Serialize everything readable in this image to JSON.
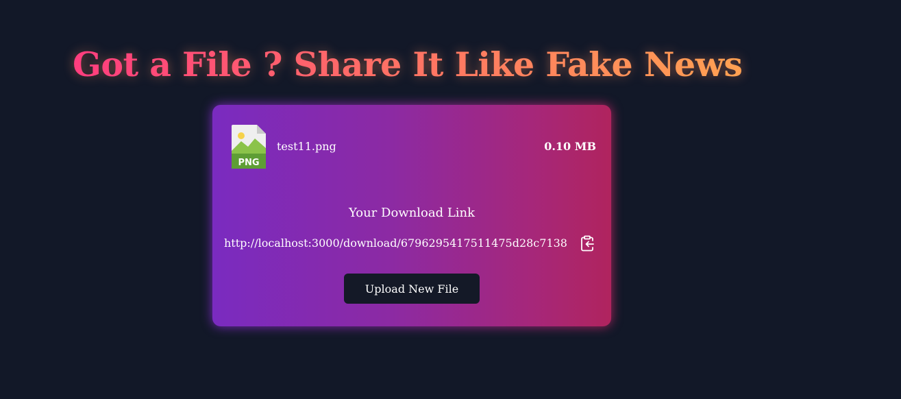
{
  "header": {
    "title": "Got a File ? Share It Like Fake News"
  },
  "file": {
    "icon": "png-file-icon",
    "type_label": "PNG",
    "name": "test11.png",
    "size": "0.10 MB"
  },
  "download": {
    "title": "Your Download Link",
    "link": "http://localhost:3000/download/6796295417511475d28c7138",
    "copy_icon": "clipboard-copy-icon"
  },
  "actions": {
    "upload_new_label": "Upload New File"
  },
  "colors": {
    "background": "#121828",
    "title_gradient_start": "#ff3d7f",
    "title_gradient_end": "#ffa152",
    "card_gradient_start": "#7a2bc0",
    "card_gradient_end": "#b0245e",
    "button_background": "#141927"
  }
}
